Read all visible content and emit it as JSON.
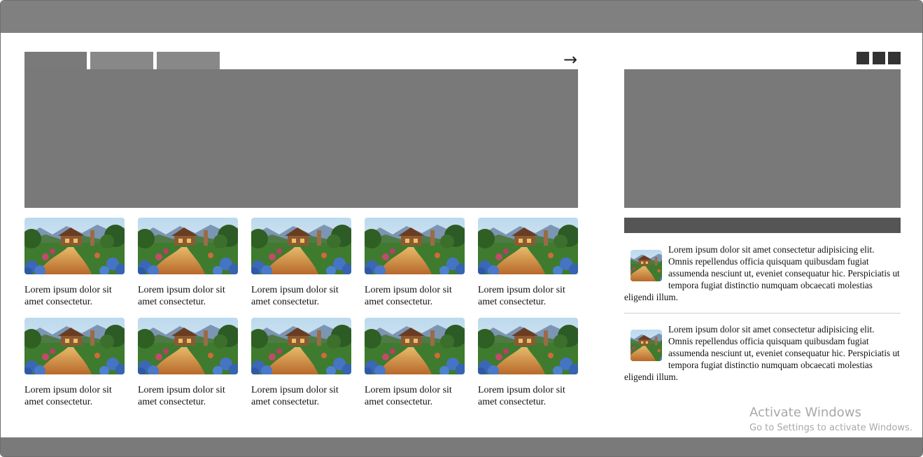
{
  "tabs": [
    "",
    "",
    ""
  ],
  "nav": {
    "next_arrow": "→"
  },
  "grid": {
    "items": [
      {
        "caption": "Lorem ipsum dolor sit amet consectetur."
      },
      {
        "caption": "Lorem ipsum dolor sit amet consectetur."
      },
      {
        "caption": "Lorem ipsum dolor sit amet consectetur."
      },
      {
        "caption": "Lorem ipsum dolor sit amet consectetur."
      },
      {
        "caption": "Lorem ipsum dolor sit amet consectetur."
      },
      {
        "caption": "Lorem ipsum dolor sit amet consectetur."
      },
      {
        "caption": "Lorem ipsum dolor sit amet consectetur."
      },
      {
        "caption": "Lorem ipsum dolor sit amet consectetur."
      },
      {
        "caption": "Lorem ipsum dolor sit amet consectetur."
      },
      {
        "caption": "Lorem ipsum dolor sit amet consectetur."
      }
    ]
  },
  "sidebar": {
    "posts": [
      {
        "text": "Lorem ipsum dolor sit amet consectetur adipisicing elit. Omnis repellendus officia quisquam quibusdam fugiat assumenda nesciunt ut, eveniet consequatur hic. Perspiciatis ut tempora fugiat distinctio numquam obcaecati molestias eligendi illum."
      },
      {
        "text": "Lorem ipsum dolor sit amet consectetur adipisicing elit. Omnis repellendus officia quisquam quibusdam fugiat assumenda nesciunt ut, eveniet consequatur hic. Perspiciatis ut tempora fugiat distinctio numquam obcaecati molestias eligendi illum."
      }
    ]
  },
  "watermark": {
    "title": "Activate Windows",
    "subtitle": "Go to Settings to activate Windows."
  },
  "colors": {
    "topbar": "#808080",
    "panel": "#797979",
    "side_header": "#555555",
    "mini_buttons": "#333333"
  }
}
